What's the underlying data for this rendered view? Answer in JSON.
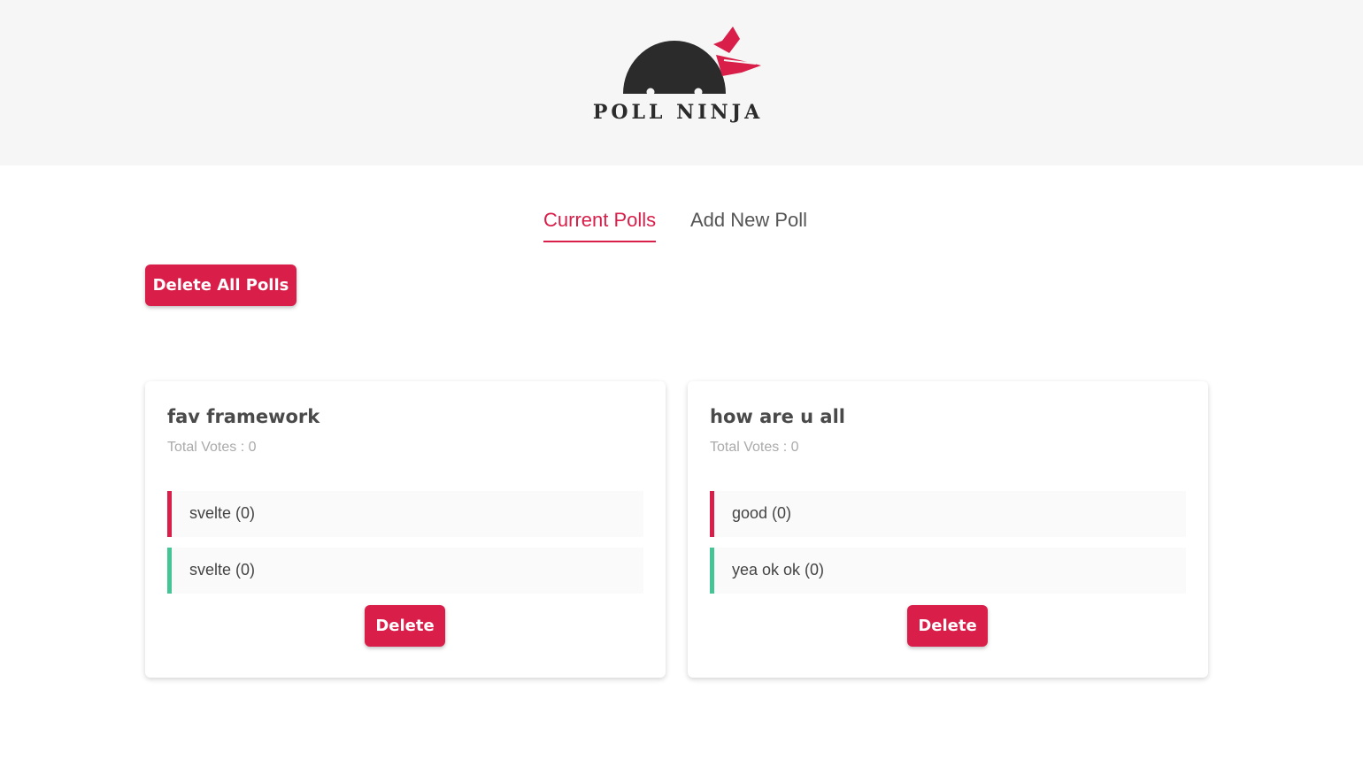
{
  "app": {
    "logo_text": "POLL NINJA"
  },
  "tabs": [
    {
      "label": "Current Polls",
      "active": true
    },
    {
      "label": "Add New Poll",
      "active": false
    }
  ],
  "actions": {
    "delete_all_label": "Delete All Polls"
  },
  "polls": [
    {
      "question": "fav framework",
      "total_votes": "Total Votes : 0",
      "answers": [
        "svelte (0)",
        "svelte (0)"
      ],
      "delete_label": "Delete"
    },
    {
      "question": "how are u all",
      "total_votes": "Total Votes : 0",
      "answers": [
        "good (0)",
        "yea ok ok (0)"
      ],
      "delete_label": "Delete"
    }
  ],
  "colors": {
    "accent": "#d81e49",
    "secondary": "#45c496",
    "header_bg": "#f6f6f6"
  }
}
